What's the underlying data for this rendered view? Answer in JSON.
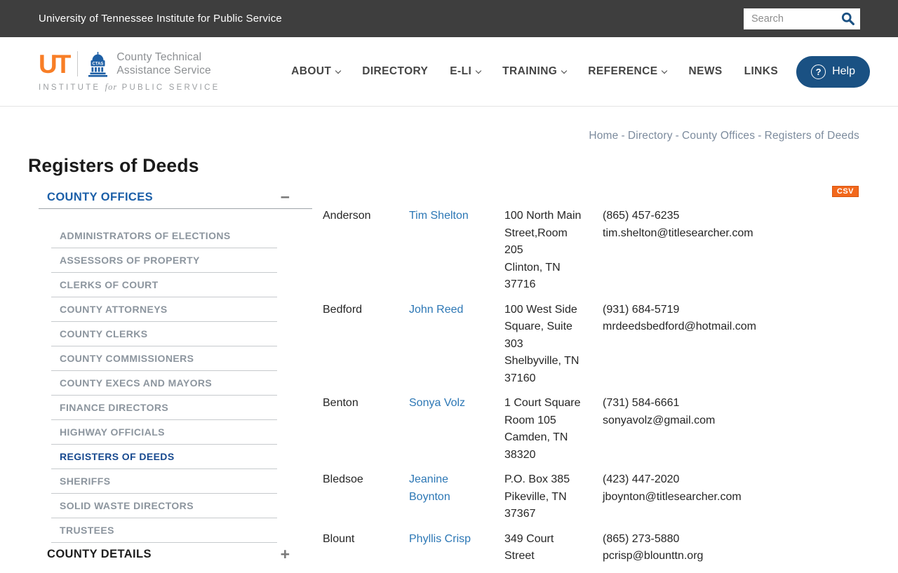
{
  "topbar": {
    "site_title": "University of Tennessee Institute for Public Service",
    "search_placeholder": "Search"
  },
  "header": {
    "logo": {
      "ut_mark": "UT",
      "ctas_label": "CTAS",
      "org_line1": "County Technical",
      "org_line2": "Assistance Service",
      "institute_pre": "INSTITUTE",
      "institute_for": "for",
      "institute_post": "PUBLIC SERVICE"
    },
    "nav": [
      {
        "label": "ABOUT",
        "has_dropdown": true
      },
      {
        "label": "DIRECTORY",
        "has_dropdown": false
      },
      {
        "label": "E-LI",
        "has_dropdown": true
      },
      {
        "label": "TRAINING",
        "has_dropdown": true
      },
      {
        "label": "REFERENCE",
        "has_dropdown": true
      },
      {
        "label": "NEWS",
        "has_dropdown": false
      },
      {
        "label": "LINKS",
        "has_dropdown": false
      }
    ],
    "help": {
      "icon_glyph": "?",
      "label": "Help"
    }
  },
  "breadcrumb": {
    "items": [
      "Home",
      "Directory",
      "County Offices",
      "Registers of Deeds"
    ],
    "separator": "-"
  },
  "page": {
    "title": "Registers of Deeds",
    "csv_label": "CSV"
  },
  "sidebar": {
    "sections": [
      {
        "label": "COUNTY OFFICES",
        "state": "expanded",
        "toggle_glyph": "−",
        "items": [
          {
            "label": "ADMINISTRATORS OF ELECTIONS",
            "active": false
          },
          {
            "label": "ASSESSORS OF PROPERTY",
            "active": false
          },
          {
            "label": "CLERKS OF COURT",
            "active": false
          },
          {
            "label": "COUNTY ATTORNEYS",
            "active": false
          },
          {
            "label": "COUNTY CLERKS",
            "active": false
          },
          {
            "label": "COUNTY COMMISSIONERS",
            "active": false
          },
          {
            "label": "COUNTY EXECS AND MAYORS",
            "active": false
          },
          {
            "label": "FINANCE DIRECTORS",
            "active": false
          },
          {
            "label": "HIGHWAY OFFICIALS",
            "active": false
          },
          {
            "label": "REGISTERS OF DEEDS",
            "active": true
          },
          {
            "label": "SHERIFFS",
            "active": false
          },
          {
            "label": "SOLID WASTE DIRECTORS",
            "active": false
          },
          {
            "label": "TRUSTEES",
            "active": false
          }
        ]
      },
      {
        "label": "COUNTY DETAILS",
        "state": "collapsed",
        "toggle_glyph": "+",
        "items": []
      }
    ]
  },
  "table": {
    "rows": [
      {
        "county": "Anderson",
        "name": "Tim Shelton",
        "address_lines": [
          "100 North Main",
          "Street,Room",
          "205",
          "Clinton, TN",
          "37716"
        ],
        "phone": "(865) 457-6235",
        "email": "tim.shelton@titlesearcher.com"
      },
      {
        "county": "Bedford",
        "name": "John Reed",
        "address_lines": [
          "100 West Side",
          "Square, Suite",
          "303",
          "Shelbyville, TN",
          "37160"
        ],
        "phone": "(931) 684-5719",
        "email": "mrdeedsbedford@hotmail.com"
      },
      {
        "county": "Benton",
        "name": "Sonya Volz",
        "address_lines": [
          "1 Court Square",
          "Room 105",
          "Camden, TN",
          "38320"
        ],
        "phone": "(731) 584-6661",
        "email": "sonyavolz@gmail.com"
      },
      {
        "county": "Bledsoe",
        "name": "Jeanine Boynton",
        "address_lines": [
          "P.O. Box 385",
          "Pikeville, TN",
          "37367"
        ],
        "phone": "(423) 447-2020",
        "email": "jboynton@titlesearcher.com"
      },
      {
        "county": "Blount",
        "name": "Phyllis Crisp",
        "address_lines": [
          "349 Court",
          "Street"
        ],
        "phone": "(865) 273-5880",
        "email": "pcrisp@blounttn.org"
      }
    ]
  },
  "colors": {
    "topbar_bg": "#3E3E3E",
    "ut_orange": "#F87E26",
    "csv_orange": "#F2681C",
    "navy": "#1A5183",
    "link_blue": "#2C77B5",
    "sidebar_heading_blue": "#1B5FA8",
    "active_item_blue": "#17498F",
    "sidebar_item_gray": "#8C959E",
    "breadcrumb_gray": "#7C8B9D"
  }
}
